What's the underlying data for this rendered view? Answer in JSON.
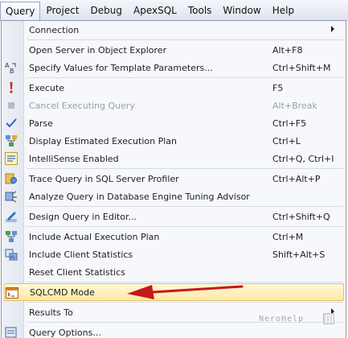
{
  "menubar": {
    "items": [
      "Query",
      "Project",
      "Debug",
      "ApexSQL",
      "Tools",
      "Window",
      "Help"
    ]
  },
  "menu": {
    "items": [
      {
        "label": "Connection",
        "shortcut": "",
        "icon": "none",
        "submenu": true
      },
      {
        "label": "Open Server in Object Explorer",
        "shortcut": "Alt+F8",
        "icon": "none"
      },
      {
        "label": "Specify Values for Template Parameters...",
        "shortcut": "Ctrl+Shift+M",
        "icon": "template-parameters-icon"
      },
      {
        "label": "Execute",
        "shortcut": "F5",
        "icon": "execute-icon"
      },
      {
        "label": "Cancel Executing Query",
        "shortcut": "Alt+Break",
        "icon": "cancel-icon",
        "disabled": true
      },
      {
        "label": "Parse",
        "shortcut": "Ctrl+F5",
        "icon": "checkmark-icon"
      },
      {
        "label": "Display Estimated Execution Plan",
        "shortcut": "Ctrl+L",
        "icon": "execution-plan-icon"
      },
      {
        "label": "IntelliSense Enabled",
        "shortcut": "Ctrl+Q, Ctrl+I",
        "icon": "intellisense-icon"
      },
      {
        "label": "Trace Query in SQL Server Profiler",
        "shortcut": "Ctrl+Alt+P",
        "icon": "profiler-icon"
      },
      {
        "label": "Analyze Query in Database Engine Tuning Advisor",
        "shortcut": "",
        "icon": "tuning-advisor-icon"
      },
      {
        "label": "Design Query in Editor...",
        "shortcut": "Ctrl+Shift+Q",
        "icon": "design-query-icon"
      },
      {
        "label": "Include Actual Execution Plan",
        "shortcut": "Ctrl+M",
        "icon": "actual-plan-icon"
      },
      {
        "label": "Include Client Statistics",
        "shortcut": "Shift+Alt+S",
        "icon": "client-statistics-icon"
      },
      {
        "label": "Reset Client Statistics",
        "shortcut": "",
        "icon": "none"
      },
      {
        "label": "SQLCMD Mode",
        "shortcut": "",
        "icon": "sqlcmd-icon",
        "highlighted": true
      },
      {
        "label": "Results To",
        "shortcut": "",
        "icon": "none",
        "submenu": true
      },
      {
        "label": "Query Options...",
        "shortcut": "",
        "icon": "query-options-icon"
      }
    ]
  },
  "watermark": {
    "text": "NeroHelp"
  },
  "colors": {
    "arrow": "#c8171d",
    "highlight": "#fde9a4",
    "highlight_border": "#e5c365"
  }
}
